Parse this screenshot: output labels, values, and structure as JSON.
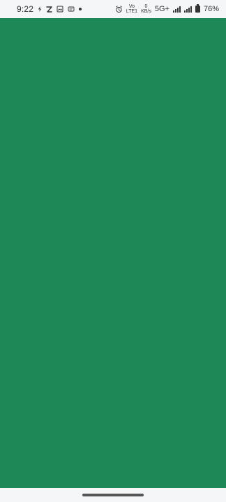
{
  "status_bar": {
    "time": "9:22",
    "network_label": "5G+",
    "battery_percent": "76%",
    "data_rate": {
      "value": "0",
      "unit": "KB/s"
    },
    "vo_lte_label": "Vo",
    "lte_label": "LTE1",
    "icons": {
      "left": [
        "lightning-icon",
        "z-app-icon",
        "gallery-icon",
        "message-icon",
        "notification-dot-icon"
      ],
      "right": [
        "alarm-icon",
        "volte-icon",
        "data-rate-icon",
        "network-type-icon",
        "signal-icon",
        "signal-icon-2",
        "battery-icon"
      ]
    }
  },
  "content": {
    "background_color": "#1e8856"
  },
  "navigation": {
    "home_indicator": true
  }
}
